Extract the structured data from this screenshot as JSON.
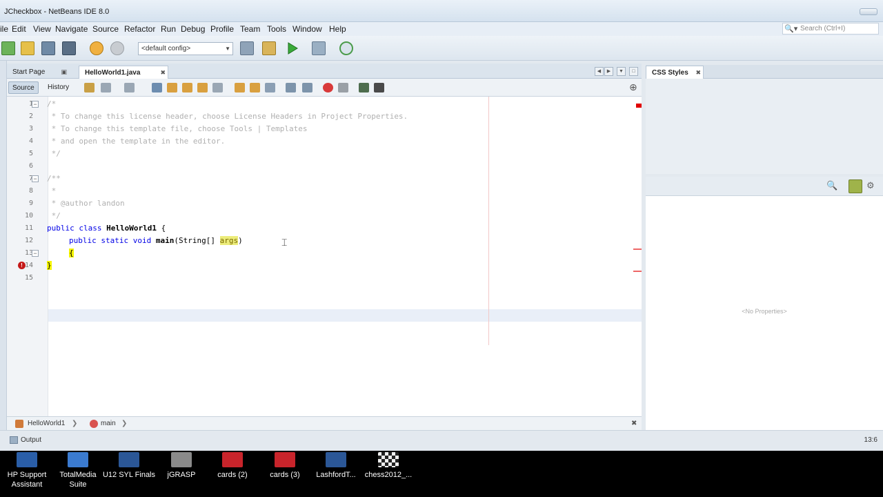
{
  "window": {
    "title": "JCheckbox - NetBeans IDE 8.0"
  },
  "menu": [
    "ile",
    "Edit",
    "View",
    "Navigate",
    "Source",
    "Refactor",
    "Run",
    "Debug",
    "Profile",
    "Team",
    "Tools",
    "Window",
    "Help"
  ],
  "search": {
    "placeholder": "Search (Ctrl+I)"
  },
  "toolbar": {
    "config_value": "<default config>"
  },
  "tabs": [
    {
      "label": "Start Page"
    },
    {
      "label": "HelloWorld1.java",
      "active": true
    }
  ],
  "editor_toolbar": {
    "source_label": "Source",
    "history_label": "History"
  },
  "line_numbers": [
    "1",
    "2",
    "3",
    "4",
    "5",
    "6",
    "7",
    "8",
    "9",
    "10",
    "11",
    "12",
    "13",
    "14",
    "15"
  ],
  "code": {
    "l1": "/*",
    "l2": " * To change this license header, choose License Headers in Project Properties.",
    "l3": " * To change this template file, choose Tools | Templates",
    "l4": " * and open the template in the editor.",
    "l5": " */",
    "l7": "/**",
    "l8": " *",
    "l9": " * @author landon",
    "l10": " */",
    "l11_kw": "public class",
    "l11_name": "HelloWorld1",
    "l11_rest": " {",
    "l12_kw": "public static void",
    "l12_name": "main",
    "l12_args": "(String[] ",
    "l12_param": "args",
    "l12_end": ")",
    "l13": "{",
    "l14": "}"
  },
  "breadcrumb": [
    "HelloWorld1",
    "main"
  ],
  "right_panel": {
    "tab_label": "CSS Styles",
    "no_properties": "<No Properties>"
  },
  "output": {
    "label": "Output",
    "position": "13:6"
  },
  "desktop_icons": [
    {
      "label": "HP Support Assistant",
      "color": "#2a5ea8"
    },
    {
      "label": "TotalMedia Suite",
      "color": "#3b7bd0"
    },
    {
      "label": "U12 SYL Finals",
      "color": "#2b5797"
    },
    {
      "label": "jGRASP",
      "color": "#8a8a8a"
    },
    {
      "label": "cards (2)",
      "color": "#c8242b"
    },
    {
      "label": "cards (3)",
      "color": "#c8242b"
    },
    {
      "label": "LashfordT...",
      "color": "#2b5797"
    },
    {
      "label": "chess2012_...",
      "color": "#e8e8e8"
    }
  ],
  "colors": {
    "keyword": "#0000e6",
    "comment": "#b0b0b0",
    "error": "#e00000",
    "highlight": "#f5f500"
  }
}
